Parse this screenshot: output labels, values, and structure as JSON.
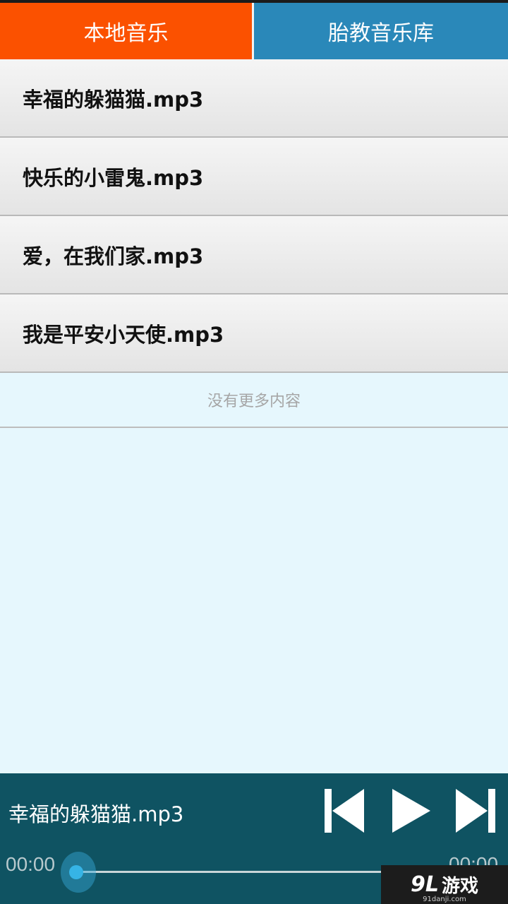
{
  "tabs": [
    {
      "label": "本地音乐",
      "active": true
    },
    {
      "label": "胎教音乐库",
      "active": false
    }
  ],
  "songs": [
    "幸福的躲猫猫.mp3",
    "快乐的小雷鬼.mp3",
    "爱，在我们家.mp3",
    "我是平安小天使.mp3"
  ],
  "no_more_text": "没有更多内容",
  "player": {
    "now_playing": "幸福的躲猫猫.mp3",
    "current_time": "00:00",
    "total_time": "00:00",
    "progress": 0.0
  },
  "watermark": {
    "logo": "9L",
    "text": "游戏",
    "sub": "91danji.com"
  },
  "colors": {
    "tab_active": "#fb5100",
    "tab_inactive": "#2a88b9",
    "player_bg": "#0f5362",
    "accent": "#36b4e6"
  },
  "icons": [
    "skip-previous-icon",
    "play-icon",
    "skip-next-icon"
  ]
}
